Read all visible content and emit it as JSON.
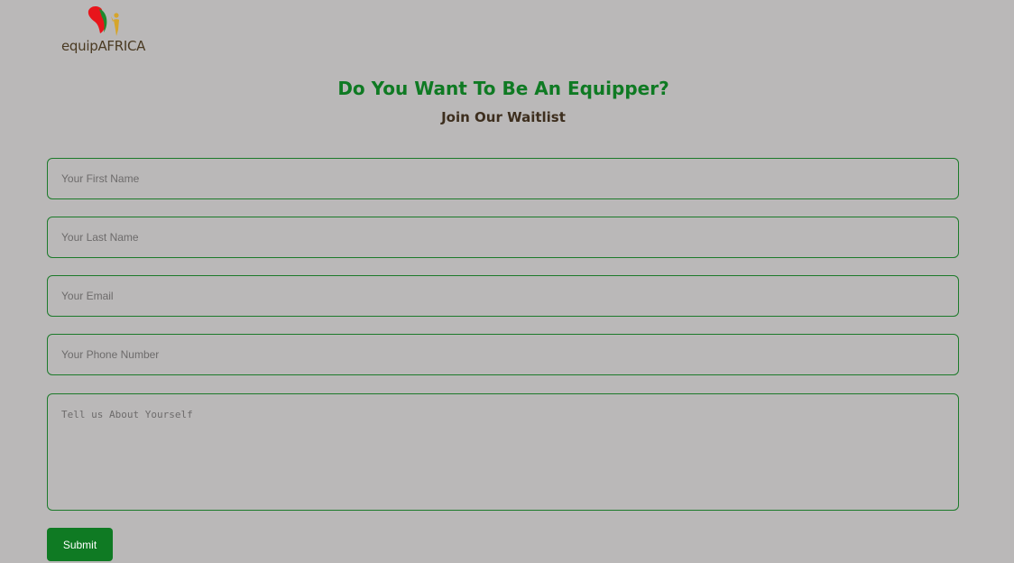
{
  "logo": {
    "text": "equipAFRICA",
    "icon": "africa-map-logo-icon",
    "colors": [
      "#e8151b",
      "#1e8a2e",
      "#d6a52a"
    ]
  },
  "header": {
    "title": "Do You Want To Be An Equipper?",
    "subtitle": "Join Our Waitlist"
  },
  "form": {
    "first_name": {
      "placeholder": "Your First Name",
      "value": ""
    },
    "last_name": {
      "placeholder": "Your Last Name",
      "value": ""
    },
    "email": {
      "placeholder": "Your Email",
      "value": ""
    },
    "phone": {
      "placeholder": "Your Phone Number",
      "value": ""
    },
    "about": {
      "placeholder": "Tell us About Yourself",
      "value": ""
    },
    "submit_label": "Submit"
  },
  "colors": {
    "accent": "#0f7a23",
    "border": "#1c7a2a",
    "background": "#bab8b8",
    "heading_dark": "#3d2e1e"
  }
}
